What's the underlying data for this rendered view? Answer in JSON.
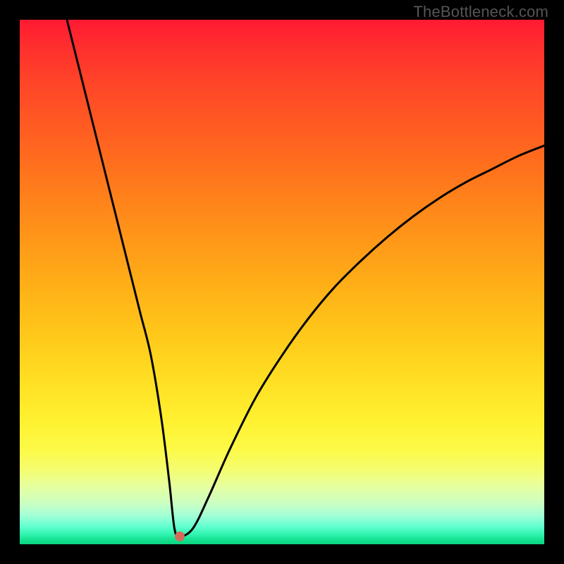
{
  "watermark": "TheBottleneck.com",
  "chart_data": {
    "type": "line",
    "title": "",
    "xlabel": "",
    "ylabel": "",
    "xlim": [
      0,
      100
    ],
    "ylim": [
      0,
      100
    ],
    "legend": false,
    "background_gradient": [
      "#ff1a33",
      "#ff5a22",
      "#ffb317",
      "#fff02f",
      "#f4fd72",
      "#a3ffd6",
      "#0ad47e"
    ],
    "series": [
      {
        "name": "bottleneck-curve",
        "color": "#000000",
        "x": [
          9,
          11,
          13,
          15,
          17,
          19,
          21,
          23,
          25,
          27,
          28.5,
          29.5,
          30.5,
          33,
          36,
          40,
          45,
          50,
          55,
          60,
          65,
          70,
          75,
          80,
          85,
          90,
          95,
          100
        ],
        "y": [
          100,
          92,
          84,
          76,
          68,
          60,
          52,
          44,
          36,
          24,
          12,
          3,
          1.5,
          3,
          9,
          18,
          28,
          36,
          43,
          49,
          54,
          58.5,
          62.5,
          66,
          69,
          71.5,
          74,
          76
        ]
      }
    ],
    "marker": {
      "x": 30.5,
      "y": 1.5,
      "color": "#d46a5a",
      "r": 7
    }
  }
}
